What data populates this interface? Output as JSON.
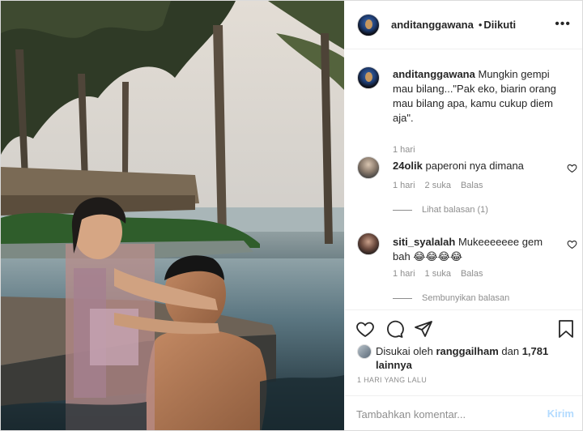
{
  "header": {
    "username": "anditanggawana",
    "separator": "•",
    "follow_status": "Diikuti",
    "more_label": "•••"
  },
  "caption": {
    "username": "anditanggawana",
    "text": "Mungkin gempi mau bilang...\"Pak eko, biarin orang mau bilang apa, kamu cukup diem aja\".",
    "time": "1 hari"
  },
  "comments": [
    {
      "username": "24olik",
      "text": "paperoni nya dimana",
      "time": "1 hari",
      "likes": "2 suka",
      "reply_label": "Balas",
      "replies_label": "Lihat balasan (1)"
    },
    {
      "username": "siti_syalalah",
      "text": "Mukeeeeeee gem bah 😂😂😂😂",
      "time": "1 hari",
      "likes": "1 suka",
      "reply_label": "Balas",
      "replies_label": "Sembunyikan balasan"
    }
  ],
  "likes": {
    "prefix": "Disukai oleh",
    "user": "ranggailham",
    "conjunction": "dan",
    "others": "1,781 lainnya"
  },
  "time_ago": "1 HARI YANG LALU",
  "add_comment": {
    "placeholder": "Tambahkan komentar...",
    "post_label": "Kirim"
  },
  "icons": {
    "like": "heart-icon",
    "comment": "comment-icon",
    "share": "share-icon",
    "save": "bookmark-icon",
    "more": "more-options-icon"
  },
  "colors": {
    "text": "#262626",
    "secondary": "#8e8e8e",
    "border": "#dbdbdb",
    "post_button_disabled": "#b3dbff"
  }
}
